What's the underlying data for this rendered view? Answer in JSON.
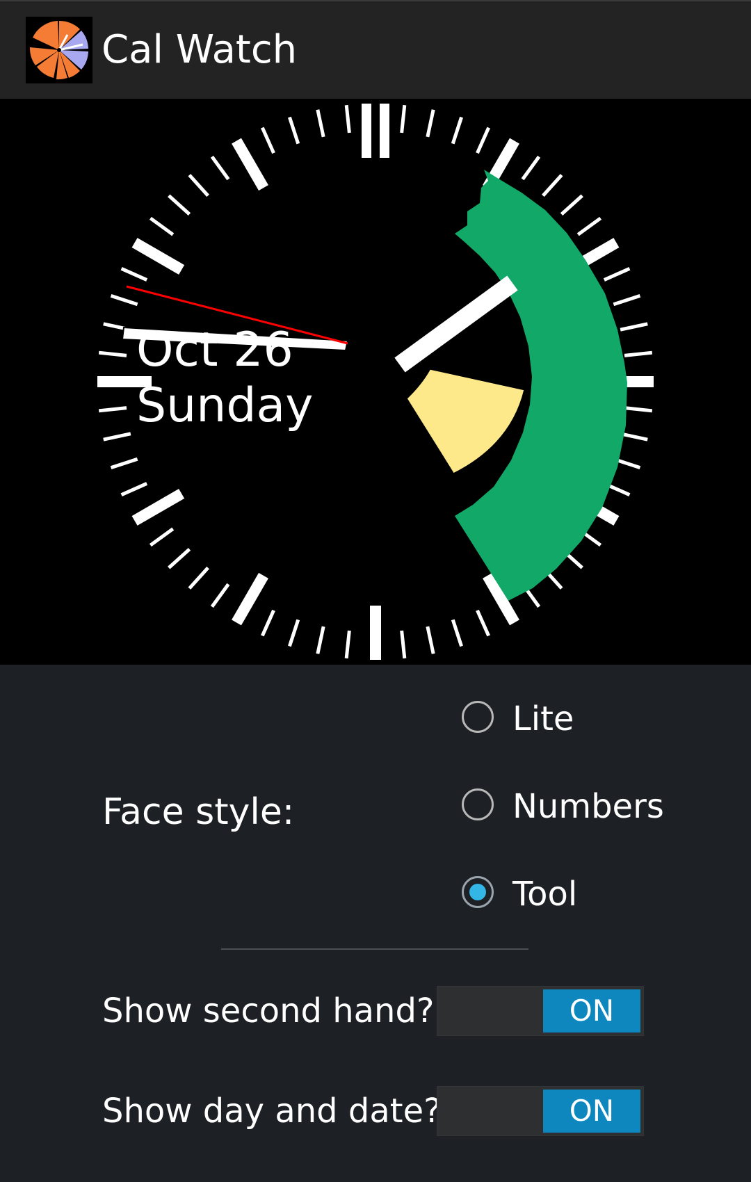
{
  "app": {
    "title": "Cal Watch",
    "icon": "app-launcher-icon"
  },
  "clock": {
    "date_text": "Oct 26",
    "day_text": "Sunday",
    "colors": {
      "face_bg": "#000000",
      "ticks": "#ffffff",
      "hands": "#ffffff",
      "second_hand": "#ff0000",
      "event_green": "#12a867",
      "event_yellow": "#fde98a"
    }
  },
  "settings": {
    "face_style_label": "Face style:",
    "face_style_options": [
      {
        "label": "Lite",
        "checked": false
      },
      {
        "label": "Numbers",
        "checked": false
      },
      {
        "label": "Tool",
        "checked": true
      }
    ],
    "show_second_hand_label": "Show second hand?",
    "show_second_hand_value": "ON",
    "show_day_date_label": "Show day and date?",
    "show_day_date_value": "ON",
    "accent_color": "#0e87be"
  }
}
